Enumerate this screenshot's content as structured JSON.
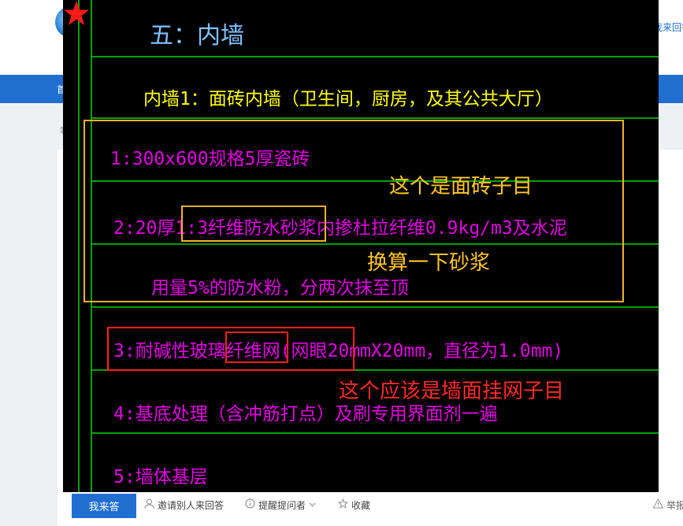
{
  "site": {
    "ask_top_label": "我来回答",
    "nav_item": "首",
    "left_text": "等"
  },
  "cad": {
    "title": "五：内墙",
    "heading": "内墙1：面砖内墙（卫生间，厨房，及其公共大厅）",
    "lines": [
      "1:300x600规格5厚瓷砖",
      "2:20厚1:3纤维防水砂浆内掺杜拉纤维0.9kg/m3及水泥",
      "用量5%的防水粉，分两次抹至顶",
      "3:耐碱性玻璃纤维网(网眼20mmX20mm，直径为1.0mm)",
      "4:基底处理（含冲筋打点）及刷专用界面剂一遍",
      "5:墙体基层"
    ],
    "colors": {
      "title": "#7fc0ff",
      "heading": "#ffff00",
      "lines": "#e000e0",
      "grid": "#00a000",
      "star": "#ff1a1a"
    }
  },
  "annotations": {
    "note_tile": "这个是面砖子目",
    "note_mortar": "换算一下砂浆",
    "note_mesh": "这个应该是墙面挂网子目",
    "colors": {
      "yellow": "#ffc726",
      "red": "#ff2a2a"
    }
  },
  "actions": {
    "answer_button": "我来答",
    "invite": "邀请别人来回答",
    "remind": "提醒提问者",
    "collect": "收藏",
    "report": "举报",
    "icons": [
      "user-icon",
      "info-icon",
      "chevron-down-icon",
      "star-icon",
      "warning-icon"
    ]
  }
}
